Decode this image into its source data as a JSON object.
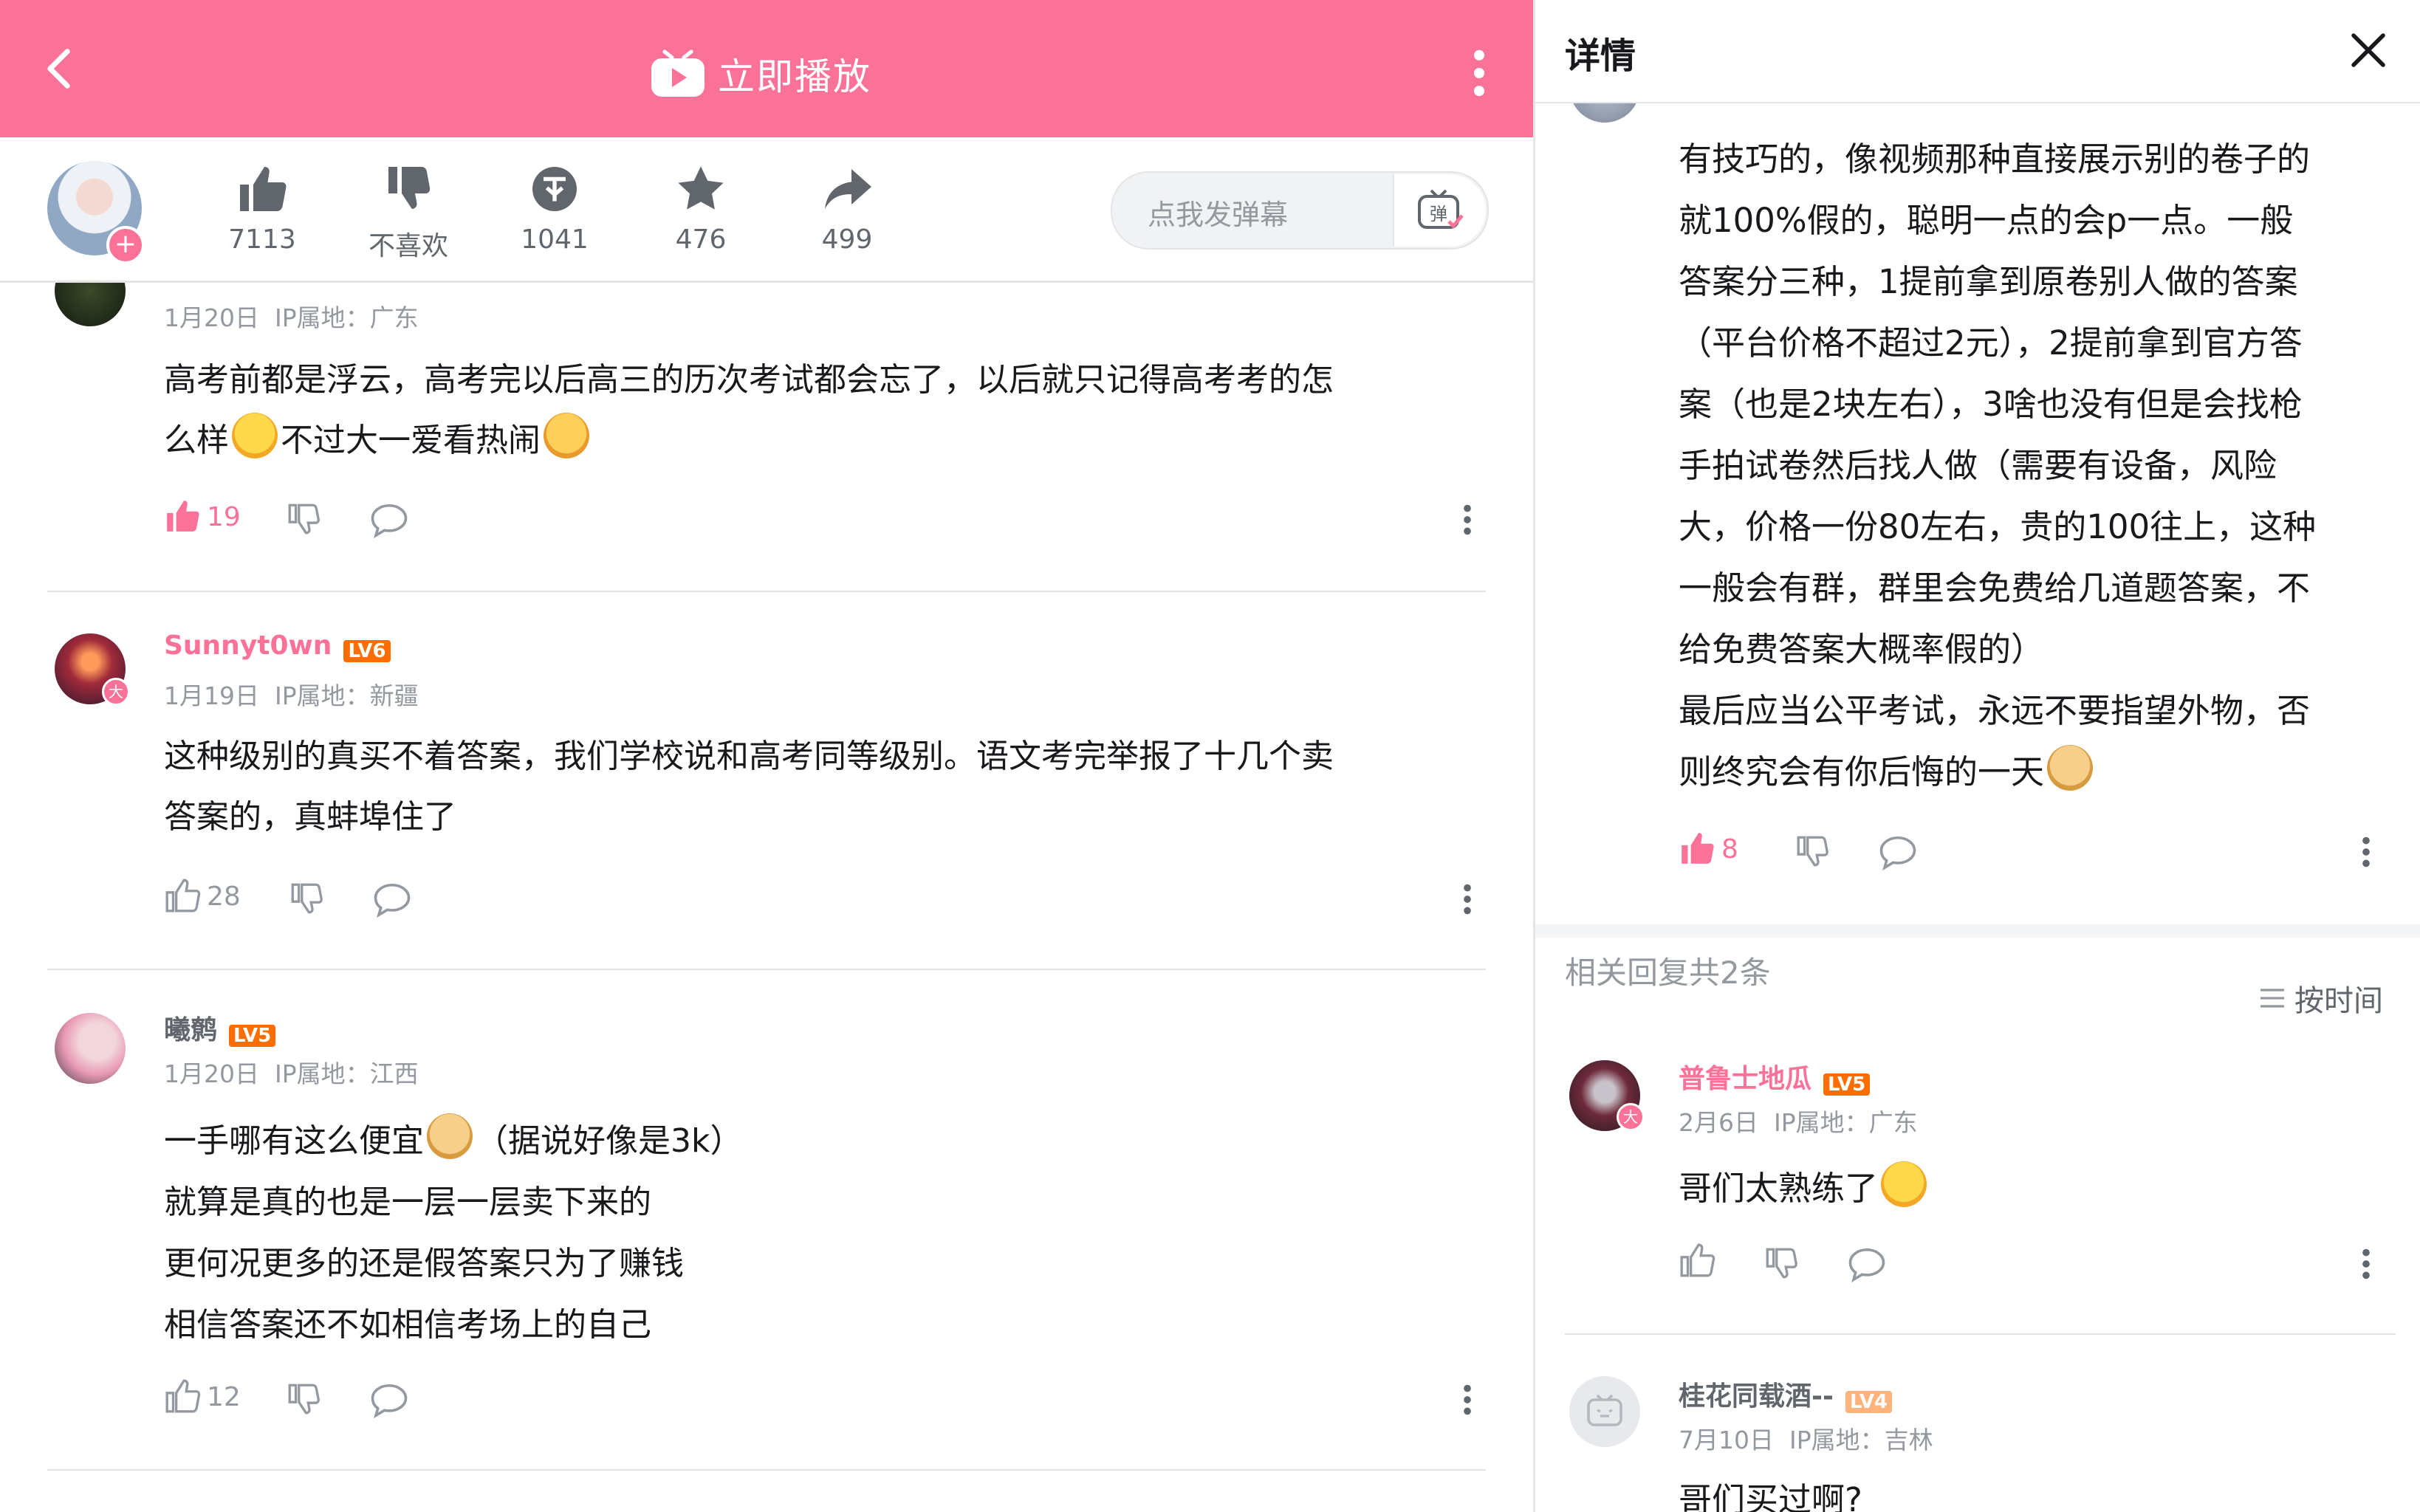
{
  "header": {
    "play_label": "立即播放"
  },
  "actions": [
    {
      "icon": "thumbs-up-icon",
      "label": "7113"
    },
    {
      "icon": "thumbs-down-icon",
      "label": "不喜欢"
    },
    {
      "icon": "coin-icon",
      "label": "1041"
    },
    {
      "icon": "star-icon",
      "label": "476"
    },
    {
      "icon": "share-icon",
      "label": "499"
    }
  ],
  "danmaku": {
    "placeholder": "点我发弹幕",
    "button": "弹"
  },
  "comments": [
    {
      "date": "1月20日",
      "ip": "IP属地：广东",
      "line1": "高考前都是浮云，高考完以后高三的历次考试都会忘了，以后就只记得高考考的怎",
      "line2a": "么样",
      "line2b": "不过大一爱看热闹",
      "likes": "19",
      "liked": true
    },
    {
      "name": "Sunnyt0wn",
      "level": "LV6",
      "date": "1月19日",
      "ip": "IP属地：新疆",
      "line1": "这种级别的真买不着答案，我们学校说和高考同等级别。语文考完举报了十几个卖",
      "line2": "答案的，真蚌埠住了",
      "likes": "28"
    },
    {
      "name": "曦鹩",
      "level": "LV5",
      "date": "1月20日",
      "ip": "IP属地：江西",
      "line1a": "一手哪有这么便宜",
      "line1b": "（据说好像是3k）",
      "line2": "就算是真的也是一层一层卖下来的",
      "line3": "更何况更多的还是假答案只为了赚钱",
      "line4": "相信答案还不如相信考场上的自己",
      "likes": "12"
    }
  ],
  "detail": {
    "title": "详情",
    "lines": [
      "有技巧的，像视频那种直接展示别的卷子的",
      "就100%假的，聪明一点的会p一点。一般",
      "答案分三种，1提前拿到原卷别人做的答案",
      "（平台价格不超过2元），2提前拿到官方答",
      "案（也是2块左右），3啥也没有但是会找枪",
      "手拍试卷然后找人做（需要有设备，风险",
      "大，价格一份80左右，贵的100往上，这种",
      "一般会有群，群里会免费给几道题答案，不",
      "给免费答案大概率假的）",
      "最后应当公平考试，永远不要指望外物，否",
      "则终究会有你后悔的一天"
    ],
    "likes": "8",
    "replies_count": "相关回复共2条",
    "sort_label": "按时间",
    "replies": [
      {
        "name": "普鲁士地瓜",
        "level": "LV5",
        "date": "2月6日",
        "ip": "IP属地：广东",
        "text": "哥们太熟练了"
      },
      {
        "name": "桂花同载酒--",
        "level": "LV4",
        "date": "7月10日",
        "ip": "IP属地：吉林",
        "text": "哥们买过啊?"
      }
    ]
  },
  "colors": {
    "brand_pink": "#fb7299",
    "lv6": "#ff6c00",
    "lv5": "#ff6c00",
    "lv4": "#ffb37c"
  }
}
